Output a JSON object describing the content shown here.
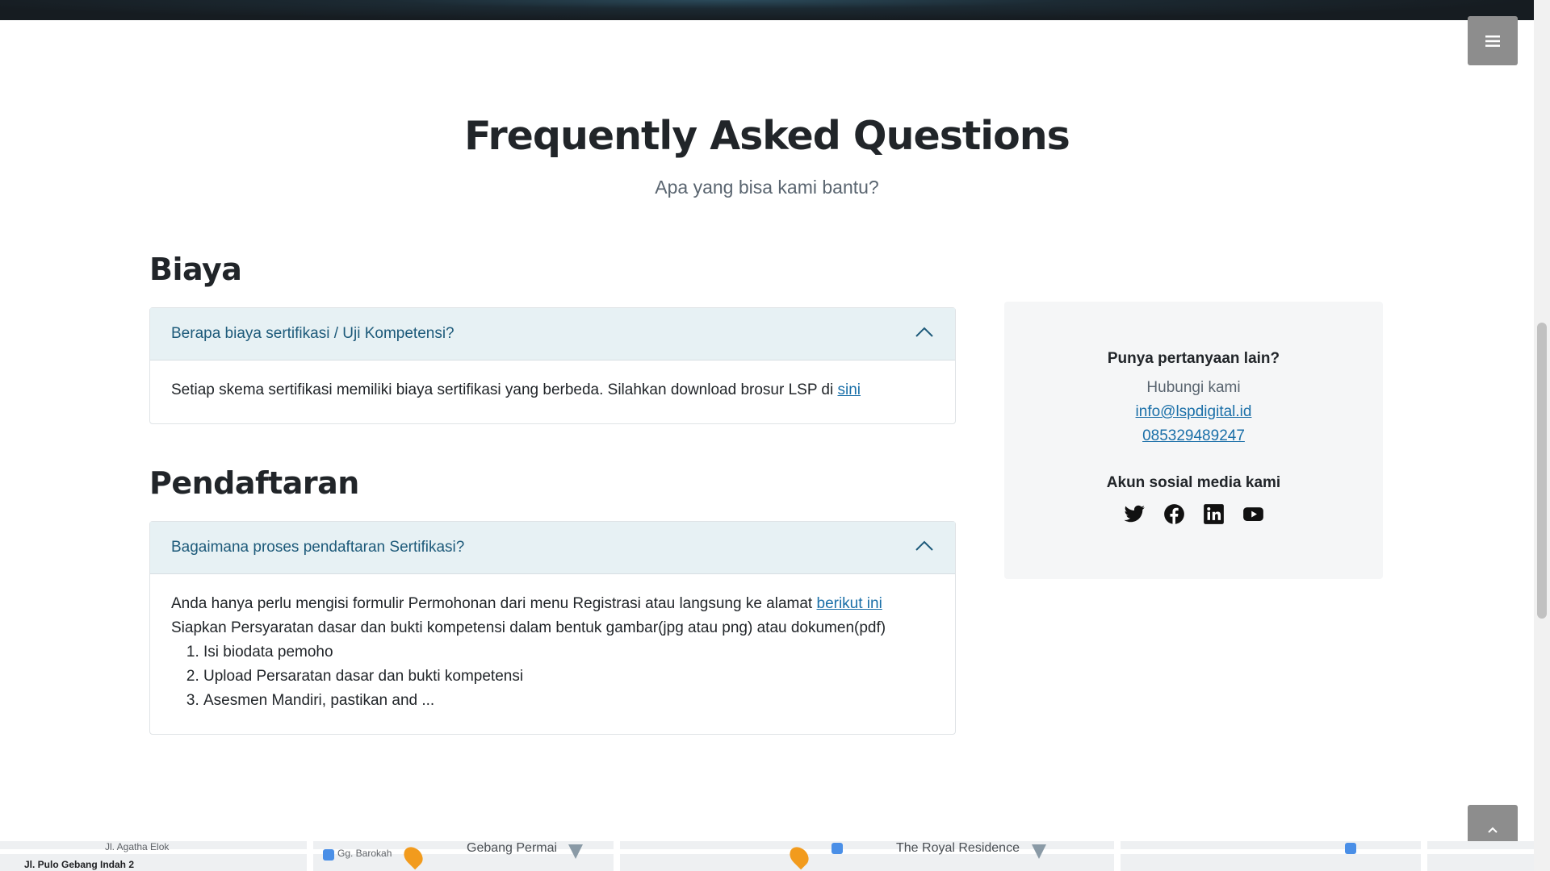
{
  "hero": {
    "title": "Frequently Asked Questions",
    "subtitle": "Apa yang bisa kami bantu?"
  },
  "sections": [
    {
      "title": "Biaya",
      "question": "Berapa biaya sertifikasi / Uji Kompetensi?",
      "answer_text": "Setiap skema sertifikasi memiliki biaya sertifikasi yang berbeda. Silahkan download brosur LSP di ",
      "answer_link": "sini"
    },
    {
      "title": "Pendaftaran",
      "question": "Bagaimana proses pendaftaran Sertifikasi?",
      "answer_line1": "Anda hanya perlu mengisi formulir Permohonan dari menu Registrasi atau langsung ke alamat ",
      "answer_link": "berikut ini",
      "answer_line2": "Siapkan Persyaratan dasar dan bukti kompetensi dalam bentuk gambar(jpg atau png) atau dokumen(pdf)",
      "steps": [
        "Isi biodata pemoho",
        "Upload Persaratan dasar dan bukti kompetensi",
        "Asesmen Mandiri, pastikan and ..."
      ]
    }
  ],
  "contact": {
    "title": "Punya pertanyaan lain?",
    "subtitle": "Hubungi kami",
    "email": "info@lspdigital.id",
    "phone": "085329489247",
    "social_title": "Akun sosial media kami",
    "social_icons": [
      "twitter-icon",
      "facebook-icon",
      "linkedin-icon",
      "youtube-icon"
    ]
  },
  "map": {
    "labels": [
      "Gg. Barokah",
      "Gebang Permai",
      "The Royal Residence",
      "Jl. Pulo Gebang Indah 2",
      "Jl. Agatha Elok"
    ]
  },
  "colors": {
    "accordion_header": "#e7f1f4",
    "question_text": "#1d5a7a",
    "link": "#1a6fa8",
    "button_grey": "#8d8d8d"
  }
}
